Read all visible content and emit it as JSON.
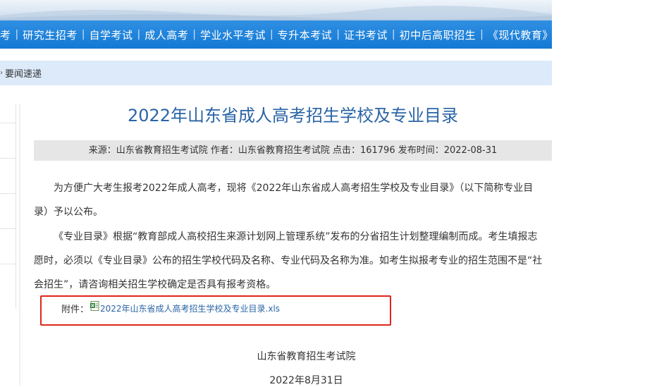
{
  "nav": {
    "items": [
      "考",
      "研究生招考",
      "自学考试",
      "成人高考",
      "学业水平考试",
      "专升本考试",
      "证书考试",
      "初中后高职招生",
      "《现代教育》"
    ]
  },
  "breadcrumb": {
    "label": "要闻速递"
  },
  "article": {
    "title": "2022年山东省成人高考招生学校及专业目录",
    "meta": "来源：山东省教育招生考试院 作者：山东省教育招生考试院 点击：161796 发布时间：2022-08-31",
    "paragraph1": "为方便广大考生报考2022年成人高考，现将《2022年山东省成人高考招生学校及专业目录》（以下简称专业目录）予以公布。",
    "paragraph2": "《专业目录》根据“教育部成人高校招生来源计划网上管理系统”发布的分省招生计划整理编制而成。考生填报志愿时，必须以《专业目录》公布的招生学校代码及名称、专业代码及名称为准。如考生拟报考专业的招生范围不是“社会招生”，请咨询相关招生学校确定是否具有报考资格。",
    "attachment_label": "附件：",
    "attachment_link": "2022年山东省成人高考招生学校及专业目录.xls",
    "org": "山东省教育招生考试院",
    "date": "2022年8月31日"
  },
  "colors": {
    "nav_bg": "#1479d4",
    "title": "#2a64a6",
    "highlight_box": "#e0251b",
    "breadcrumb_bg": "#dceafa"
  }
}
